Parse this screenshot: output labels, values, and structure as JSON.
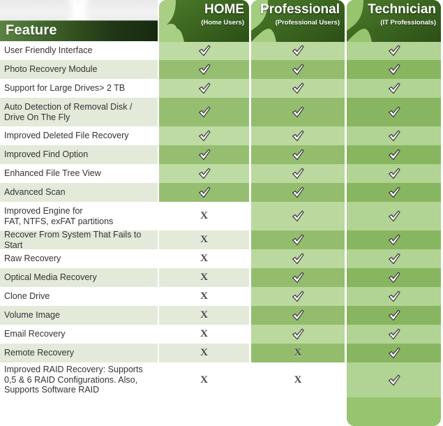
{
  "feature_header": {
    "label": "Feature"
  },
  "columns": [
    {
      "id": "home",
      "title": "HOME",
      "subtitle": "(Home Users)"
    },
    {
      "id": "professional",
      "title": "Professional",
      "subtitle": "(Professional Users)"
    },
    {
      "id": "technician",
      "title": "Technician",
      "subtitle": "(IT Professionals)"
    }
  ],
  "rows": [
    {
      "feature": "User Friendly Interface",
      "home": "check",
      "professional": "check",
      "technician": "check"
    },
    {
      "feature": "Photo Recovery Module",
      "home": "check",
      "professional": "check",
      "technician": "check"
    },
    {
      "feature": "Support for Large Drives> 2 TB",
      "home": "check",
      "professional": "check",
      "technician": "check"
    },
    {
      "feature": "Auto Detection of Removal Disk /\nDrive On The Fly",
      "home": "check",
      "professional": "check",
      "technician": "check"
    },
    {
      "feature": "Improved Deleted File Recovery",
      "home": "check",
      "professional": "check",
      "technician": "check"
    },
    {
      "feature": "Improved Find Option",
      "home": "check",
      "professional": "check",
      "technician": "check"
    },
    {
      "feature": "Enhanced File Tree View",
      "home": "check",
      "professional": "check",
      "technician": "check"
    },
    {
      "feature": "Advanced Scan",
      "home": "check",
      "professional": "check",
      "technician": "check"
    },
    {
      "feature": "Improved Engine for\nFAT, NTFS, exFAT partitions",
      "home": "cross",
      "professional": "check",
      "technician": "check"
    },
    {
      "feature": "Recover From System That Fails to Start",
      "home": "cross",
      "professional": "check",
      "technician": "check"
    },
    {
      "feature": "Raw Recovery",
      "home": "cross",
      "professional": "check",
      "technician": "check"
    },
    {
      "feature": "Optical Media Recovery",
      "home": "cross",
      "professional": "check",
      "technician": "check"
    },
    {
      "feature": "Clone Drive",
      "home": "cross",
      "professional": "check",
      "technician": "check"
    },
    {
      "feature": "Volume Image",
      "home": "cross",
      "professional": "check",
      "technician": "check"
    },
    {
      "feature": "Email Recovery",
      "home": "cross",
      "professional": "check",
      "technician": "check"
    },
    {
      "feature": "Remote Recovery",
      "home": "cross",
      "professional": "cross",
      "technician": "check"
    },
    {
      "feature": "Improved RAID Recovery: Supports\n0,5 & 6 RAID Configurations. Also,\nSupports Software RAID",
      "home": "cross",
      "professional": "cross",
      "technician": "check"
    }
  ],
  "marks": {
    "check_icon": "check-icon",
    "cross_icon": "cross-icon",
    "cross_glyph": "X"
  },
  "colors": {
    "header_dark_green": "#2b4f16",
    "feature_bar_left": "#5c8241",
    "feature_bar_right": "#182a10",
    "band_home": "#a8cf84",
    "band_professional": "#a4cd7f",
    "band_technician": "#97c46f",
    "row_alt": "#e3ead9",
    "text": "#333333"
  }
}
